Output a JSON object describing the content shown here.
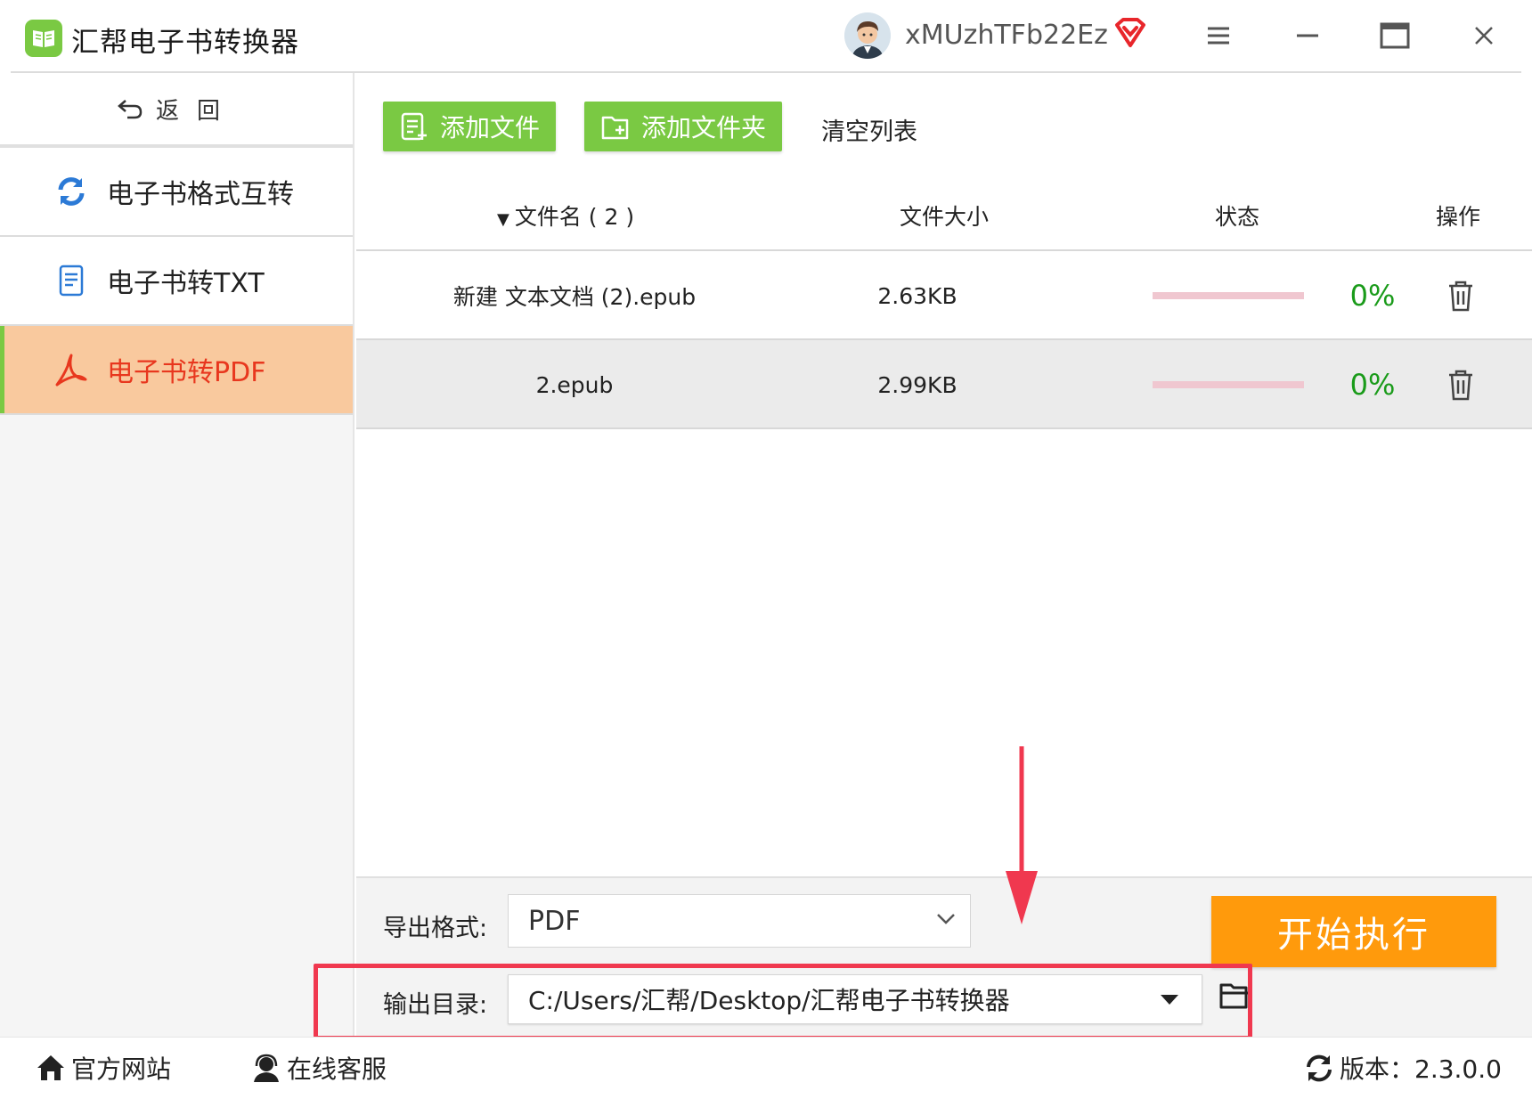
{
  "app": {
    "title": "汇帮电子书转换器",
    "username": "xMUzhTFb22Ez"
  },
  "sidebar": {
    "back_label": "返回",
    "items": [
      {
        "label": "电子书格式互转",
        "icon": "refresh-icon"
      },
      {
        "label": "电子书转TXT",
        "icon": "document-icon"
      },
      {
        "label": "电子书转PDF",
        "icon": "pdf-icon",
        "active": true
      }
    ]
  },
  "toolbar": {
    "add_file": "添加文件",
    "add_folder": "添加文件夹",
    "clear_list": "清空列表"
  },
  "table": {
    "headers": {
      "name": "文件名 ( 2 )",
      "size": "文件大小",
      "status": "状态",
      "action": "操作"
    },
    "rows": [
      {
        "name": "新建 文本文档 (2).epub",
        "size": "2.63KB",
        "progress": "0%"
      },
      {
        "name": "2.epub",
        "size": "2.99KB",
        "progress": "0%"
      }
    ]
  },
  "bottom": {
    "export_format_label": "导出格式:",
    "export_format_value": "PDF",
    "output_dir_label": "输出目录:",
    "output_dir_value": "C:/Users/汇帮/Desktop/汇帮电子书转换器",
    "start_label": "开始执行"
  },
  "statusbar": {
    "website": "官方网站",
    "support": "在线客服",
    "version": "版本：2.3.0.0"
  },
  "colors": {
    "accent_green": "#7ac943",
    "start_orange": "#ff9a0c",
    "active_bg": "#f9c99e",
    "active_text": "#e8371e",
    "highlight_red": "#f0384f",
    "progress_green": "#1a9b1a"
  }
}
